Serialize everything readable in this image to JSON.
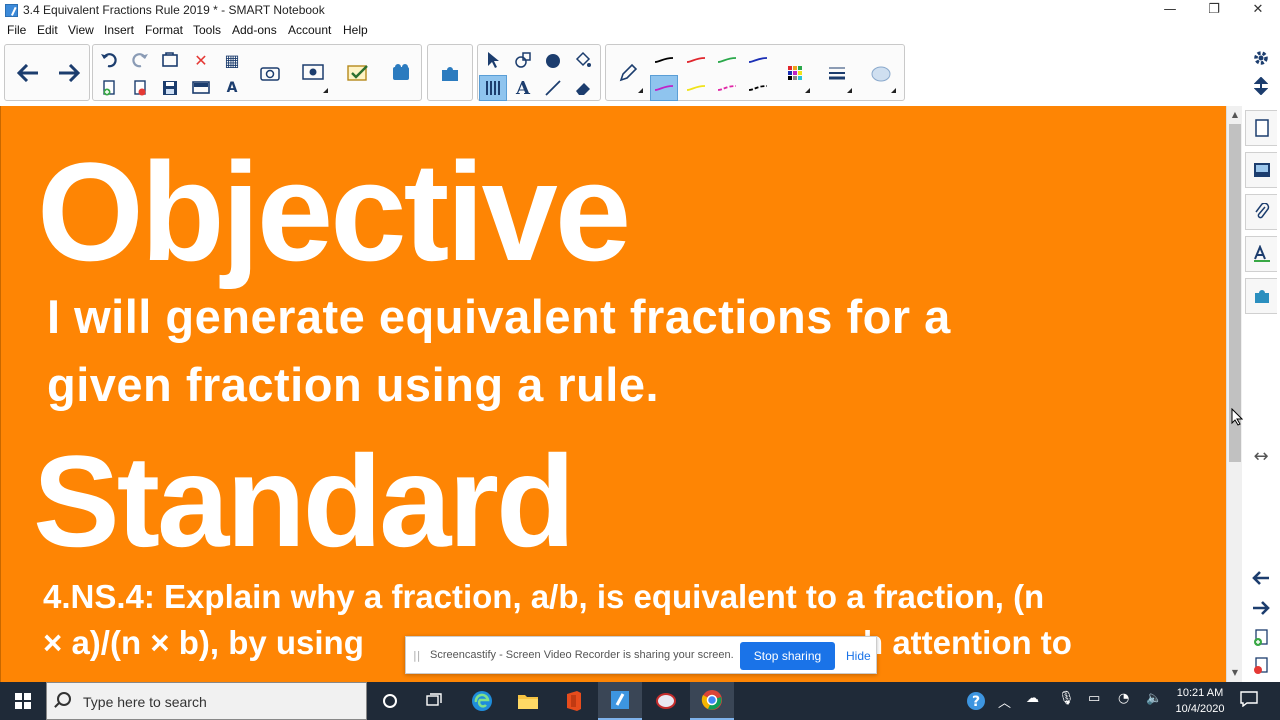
{
  "window": {
    "title": "3.4 Equivalent Fractions Rule 2019 * - SMART Notebook",
    "minimize_glyph": "—",
    "restore_glyph": "❐",
    "close_glyph": "✕"
  },
  "menu": [
    "File",
    "Edit",
    "View",
    "Insert",
    "Format",
    "Tools",
    "Add-ons",
    "Account",
    "Help"
  ],
  "toolbar": {
    "text_tool_glyph": "A",
    "table_tool_glyph": "▦",
    "pen_colors": [
      "#000000",
      "#e0262d",
      "#2aa84a",
      "#1b2fb5"
    ],
    "pen_colors_row2": [
      "#c023c7",
      "#f0e31a",
      "#e026a7",
      "#000000"
    ]
  },
  "slide": {
    "heading_objective": "Objective",
    "objective_line1": "I will generate equivalent fractions for a",
    "objective_line2": "given fraction using a rule.",
    "heading_standard": "Standard",
    "standard_line1": "4.NS.4: Explain why a fraction, a/b, is equivalent to a fraction, (n",
    "standard_line2_a": "× a)/(n × b), by using",
    "standard_line2_b": "h attention to",
    "background_color": "#fe8504"
  },
  "share_banner": {
    "message": "Screencastify - Screen Video Recorder is sharing your screen.",
    "stop_label": "Stop sharing",
    "hide_label": "Hide"
  },
  "taskbar": {
    "search_placeholder": "Type here to search",
    "time": "10:21 AM",
    "date": "10/4/2020"
  }
}
